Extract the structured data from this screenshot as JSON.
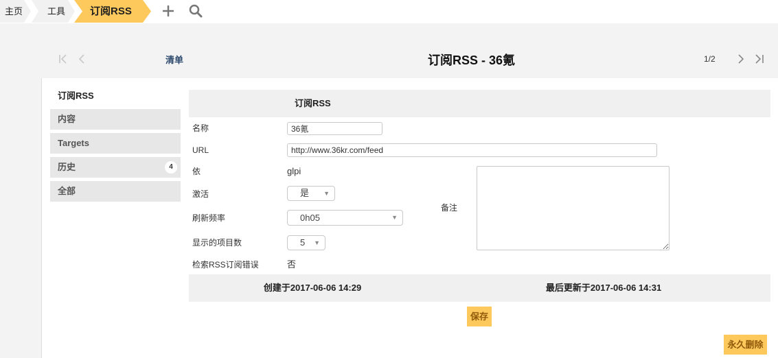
{
  "colors": {
    "accent": "#fec95c",
    "button_text": "#8f5a0a",
    "link": "#2d4a6e"
  },
  "breadcrumb": {
    "items": [
      {
        "label": "主页"
      },
      {
        "label": "工具"
      },
      {
        "label": "订阅RSS",
        "current": true
      }
    ]
  },
  "toolbar": {
    "add_icon": "plus-icon",
    "search_icon": "search-icon"
  },
  "nav": {
    "first_icon": "first-page-icon",
    "prev_icon": "previous-icon",
    "list_label": "清单",
    "title": "订阅RSS - 36氪",
    "pager": "1/2",
    "next_icon": "next-icon",
    "last_icon": "last-page-icon"
  },
  "tabs": [
    {
      "label": "订阅RSS",
      "active": true
    },
    {
      "label": "内容"
    },
    {
      "label": "Targets"
    },
    {
      "label": "历史",
      "badge": "4"
    },
    {
      "label": "全部"
    }
  ],
  "form": {
    "header": "订阅RSS",
    "fields": {
      "name": {
        "label": "名称",
        "value": "36氪"
      },
      "url": {
        "label": "URL",
        "value": "http://www.36kr.com/feed"
      },
      "by": {
        "label": "依",
        "value": "glpi"
      },
      "active": {
        "label": "激活",
        "value": "是"
      },
      "refresh_rate": {
        "label": "刷新频率",
        "value": "0h05"
      },
      "max_items": {
        "label": "显示的项目数",
        "value": "5"
      },
      "fetch_errors": {
        "label": "检索RSS订阅错误",
        "value": "否"
      },
      "comment": {
        "label": "备注"
      }
    },
    "created": "创建于2017-06-06 14:29",
    "updated": "最后更新于2017-06-06 14:31",
    "save_label": "保存",
    "purge_label": "永久删除"
  }
}
